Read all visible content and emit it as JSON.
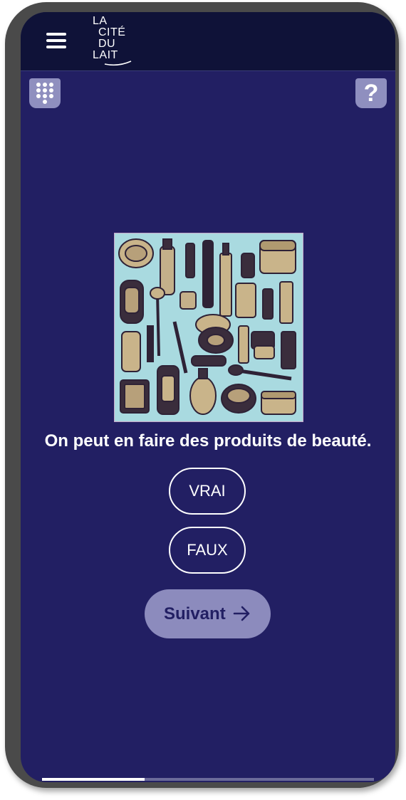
{
  "header": {
    "logo_lines": [
      "LA",
      "CITÉ",
      "DU",
      "LAIT"
    ]
  },
  "toolbar": {
    "keypad_icon": "keypad-icon",
    "help_label": "?"
  },
  "quiz": {
    "image_alt": "cosmetics-illustration",
    "question": "On peut en faire des produits de beauté.",
    "answers": [
      "VRAI",
      "FAUX"
    ],
    "next_label": "Suivant",
    "progress": 0.31
  },
  "colors": {
    "background": "#221f63",
    "topbar": "#0f1238",
    "accent": "#8c8bbd"
  }
}
